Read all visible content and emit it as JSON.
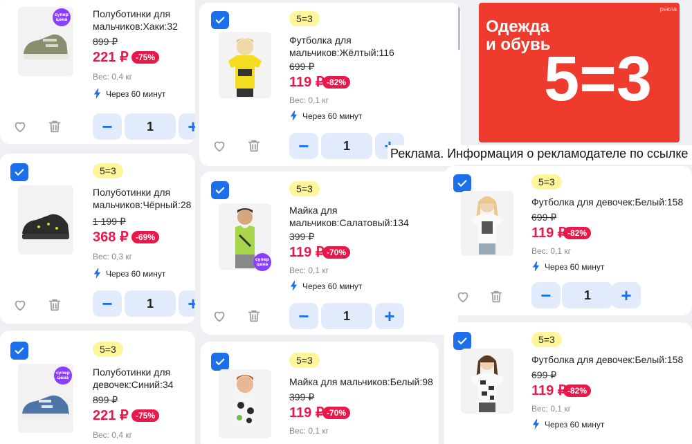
{
  "banner": {
    "label_small": "рекла",
    "title_line1": "Одежда",
    "title_line2": "и обувь",
    "big": "5=3",
    "ad_note": "Реклама. Информация о рекламодателе по ссылке"
  },
  "sticker_text": "супер цена",
  "products": [
    {
      "promo": "",
      "title_l1": "Полуботинки для",
      "title_l2": "мальчиков:Хаки:32",
      "old_price": "899 ₽",
      "price": "221 ₽",
      "discount": "-75%",
      "weight": "Вес: 0,4 кг",
      "delivery": "Через 60 минут",
      "qty": "1",
      "image": "khaki-sneaker"
    },
    {
      "promo": "5=3",
      "title_l1": "Футболка для",
      "title_l2": "мальчиков:Жёлтый:116",
      "old_price": "699 ₽",
      "price": "119 ₽",
      "discount": "-82%",
      "weight": "Вес: 0,1 кг",
      "delivery": "Через 60 минут",
      "qty": "1",
      "image": "boy-yellow-tshirt"
    },
    {
      "promo": "5=3",
      "title_l1": "Полуботинки для",
      "title_l2": "мальчиков:Чёрный:28",
      "old_price": "1 199 ₽",
      "price": "368 ₽",
      "discount": "-69%",
      "weight": "Вес: 0,3 кг",
      "delivery": "Через 60 минут",
      "qty": "1",
      "image": "black-sneaker"
    },
    {
      "promo": "5=3",
      "title_l1": "Майка для",
      "title_l2": "мальчиков:Салатовый:134",
      "old_price": "399 ₽",
      "price": "119 ₽",
      "discount": "-70%",
      "weight": "Вес: 0,1 кг",
      "delivery": "Через 60 минут",
      "qty": "1",
      "image": "boy-green-tank"
    },
    {
      "promo": "5=3",
      "title_l1": "Футболка для девочек:Белый:158",
      "title_l2": "",
      "old_price": "699 ₽",
      "price": "119 ₽",
      "discount": "-82%",
      "weight": "Вес: 0,1 кг",
      "delivery": "Через 60 минут",
      "qty": "1",
      "image": "girl-white-tshirt"
    },
    {
      "promo": "5=3",
      "title_l1": "Полуботинки для",
      "title_l2": "девочек:Синий:34",
      "old_price": "899 ₽",
      "price": "221 ₽",
      "discount": "-75%",
      "weight": "Вес: 0,4 кг",
      "delivery": "",
      "qty": "",
      "image": "blue-sneaker"
    },
    {
      "promo": "5=3",
      "title_l1": "Майка для мальчиков:Белый:98",
      "title_l2": "",
      "old_price": "399 ₽",
      "price": "119 ₽",
      "discount": "-70%",
      "weight": "Вес: 0,1 кг",
      "delivery": "",
      "qty": "",
      "image": "boy-camo-tank"
    },
    {
      "promo": "5=3",
      "title_l1": "Футболка для девочек:Белый:158",
      "title_l2": "",
      "old_price": "699 ₽",
      "price": "119 ₽",
      "discount": "-82%",
      "weight": "Вес: 0,1 кг",
      "delivery": "Через 60 минут",
      "qty": "",
      "image": "girl-print-tshirt"
    }
  ],
  "colors": {
    "accent": "#1c6fe8",
    "price": "#e8194a",
    "promo_bg": "#fff59a",
    "banner": "#ef3b2d"
  }
}
